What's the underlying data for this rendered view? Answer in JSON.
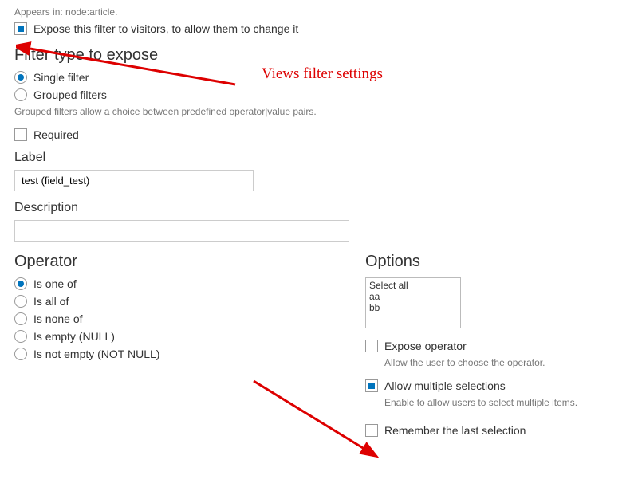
{
  "appears_in": "Appears in: node:article.",
  "expose_filter_label": "Expose this filter to visitors, to allow them to change it",
  "filter_type": {
    "title": "Filter type to expose",
    "single": "Single filter",
    "grouped": "Grouped filters",
    "help": "Grouped filters allow a choice between predefined operator|value pairs."
  },
  "required_label": "Required",
  "label": {
    "title": "Label",
    "value": "test (field_test)"
  },
  "description": {
    "title": "Description",
    "value": ""
  },
  "operator": {
    "title": "Operator",
    "options": [
      "Is one of",
      "Is all of",
      "Is none of",
      "Is empty (NULL)",
      "Is not empty (NOT NULL)"
    ]
  },
  "options": {
    "title": "Options",
    "items": [
      "Select all",
      "aa",
      "bb"
    ]
  },
  "expose_operator": {
    "label": "Expose operator",
    "help": "Allow the user to choose the operator."
  },
  "allow_multiple": {
    "label": "Allow multiple selections",
    "help": "Enable to allow users to select multiple items."
  },
  "remember_last": {
    "label": "Remember the last selection"
  },
  "annotation": {
    "title": "Views filter settings"
  }
}
